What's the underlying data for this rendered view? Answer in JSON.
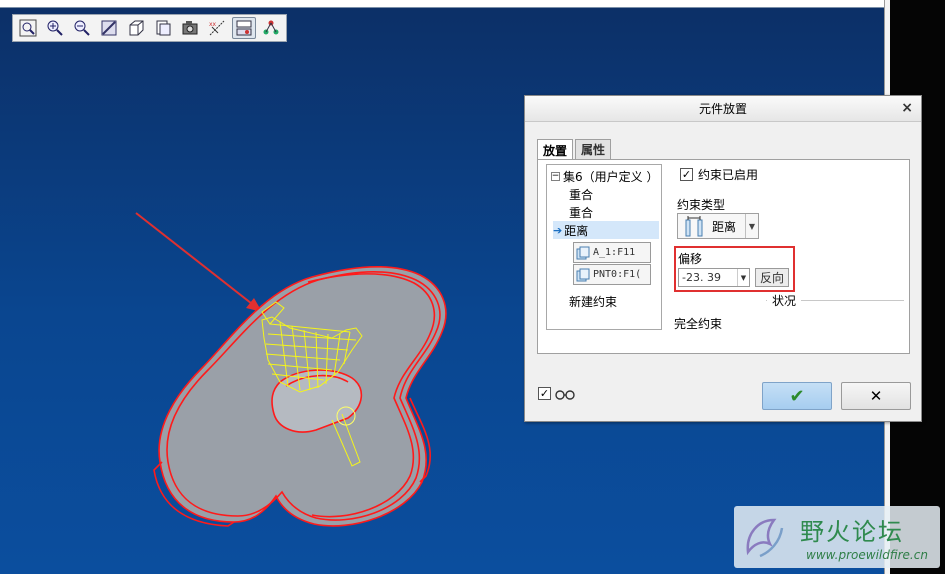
{
  "dialog": {
    "title": "元件放置",
    "close_glyph": "×",
    "tabs": [
      {
        "label": "放置"
      },
      {
        "label": "属性"
      }
    ],
    "tree": {
      "set_label": "集6（用户定义 ）",
      "items": [
        {
          "label": "重合"
        },
        {
          "label": "重合"
        },
        {
          "label": "距离",
          "selected": true
        }
      ],
      "refs": [
        {
          "label": "A_1:F11"
        },
        {
          "label": "PNT0:F1("
        }
      ],
      "new_constraint": "新建约束"
    },
    "constraint_enabled": {
      "label": "约束已启用",
      "checked": true
    },
    "constraint_type": {
      "label": "约束类型",
      "value": "距离"
    },
    "offset": {
      "label": "偏移",
      "value": "-23. 39",
      "flip_label": "反向"
    },
    "status": {
      "title": "状况",
      "value": "完全约束"
    },
    "footer": {
      "preview_checked": true,
      "ok_glyph": "✔",
      "cancel_glyph": "✕"
    }
  },
  "toolbar": {
    "icons": [
      "zoom-fit-icon",
      "zoom-in-icon",
      "zoom-out-icon",
      "repaint-icon",
      "saved-view-icon",
      "view-manager-icon",
      "display-style-icon",
      "datum-display-icon",
      "spin-center-icon",
      "annotation-icon"
    ]
  },
  "watermark": {
    "name": "野火论坛",
    "url": "www.proewildfire.cn"
  },
  "colors": {
    "viewport_top": "#0c2f66",
    "viewport_bottom": "#0b4e9e",
    "highlight": "#e03030",
    "model_edge": "#ff1a1a",
    "model_fill": "#9aa0a8",
    "part_yellow": "#f5f51a"
  }
}
